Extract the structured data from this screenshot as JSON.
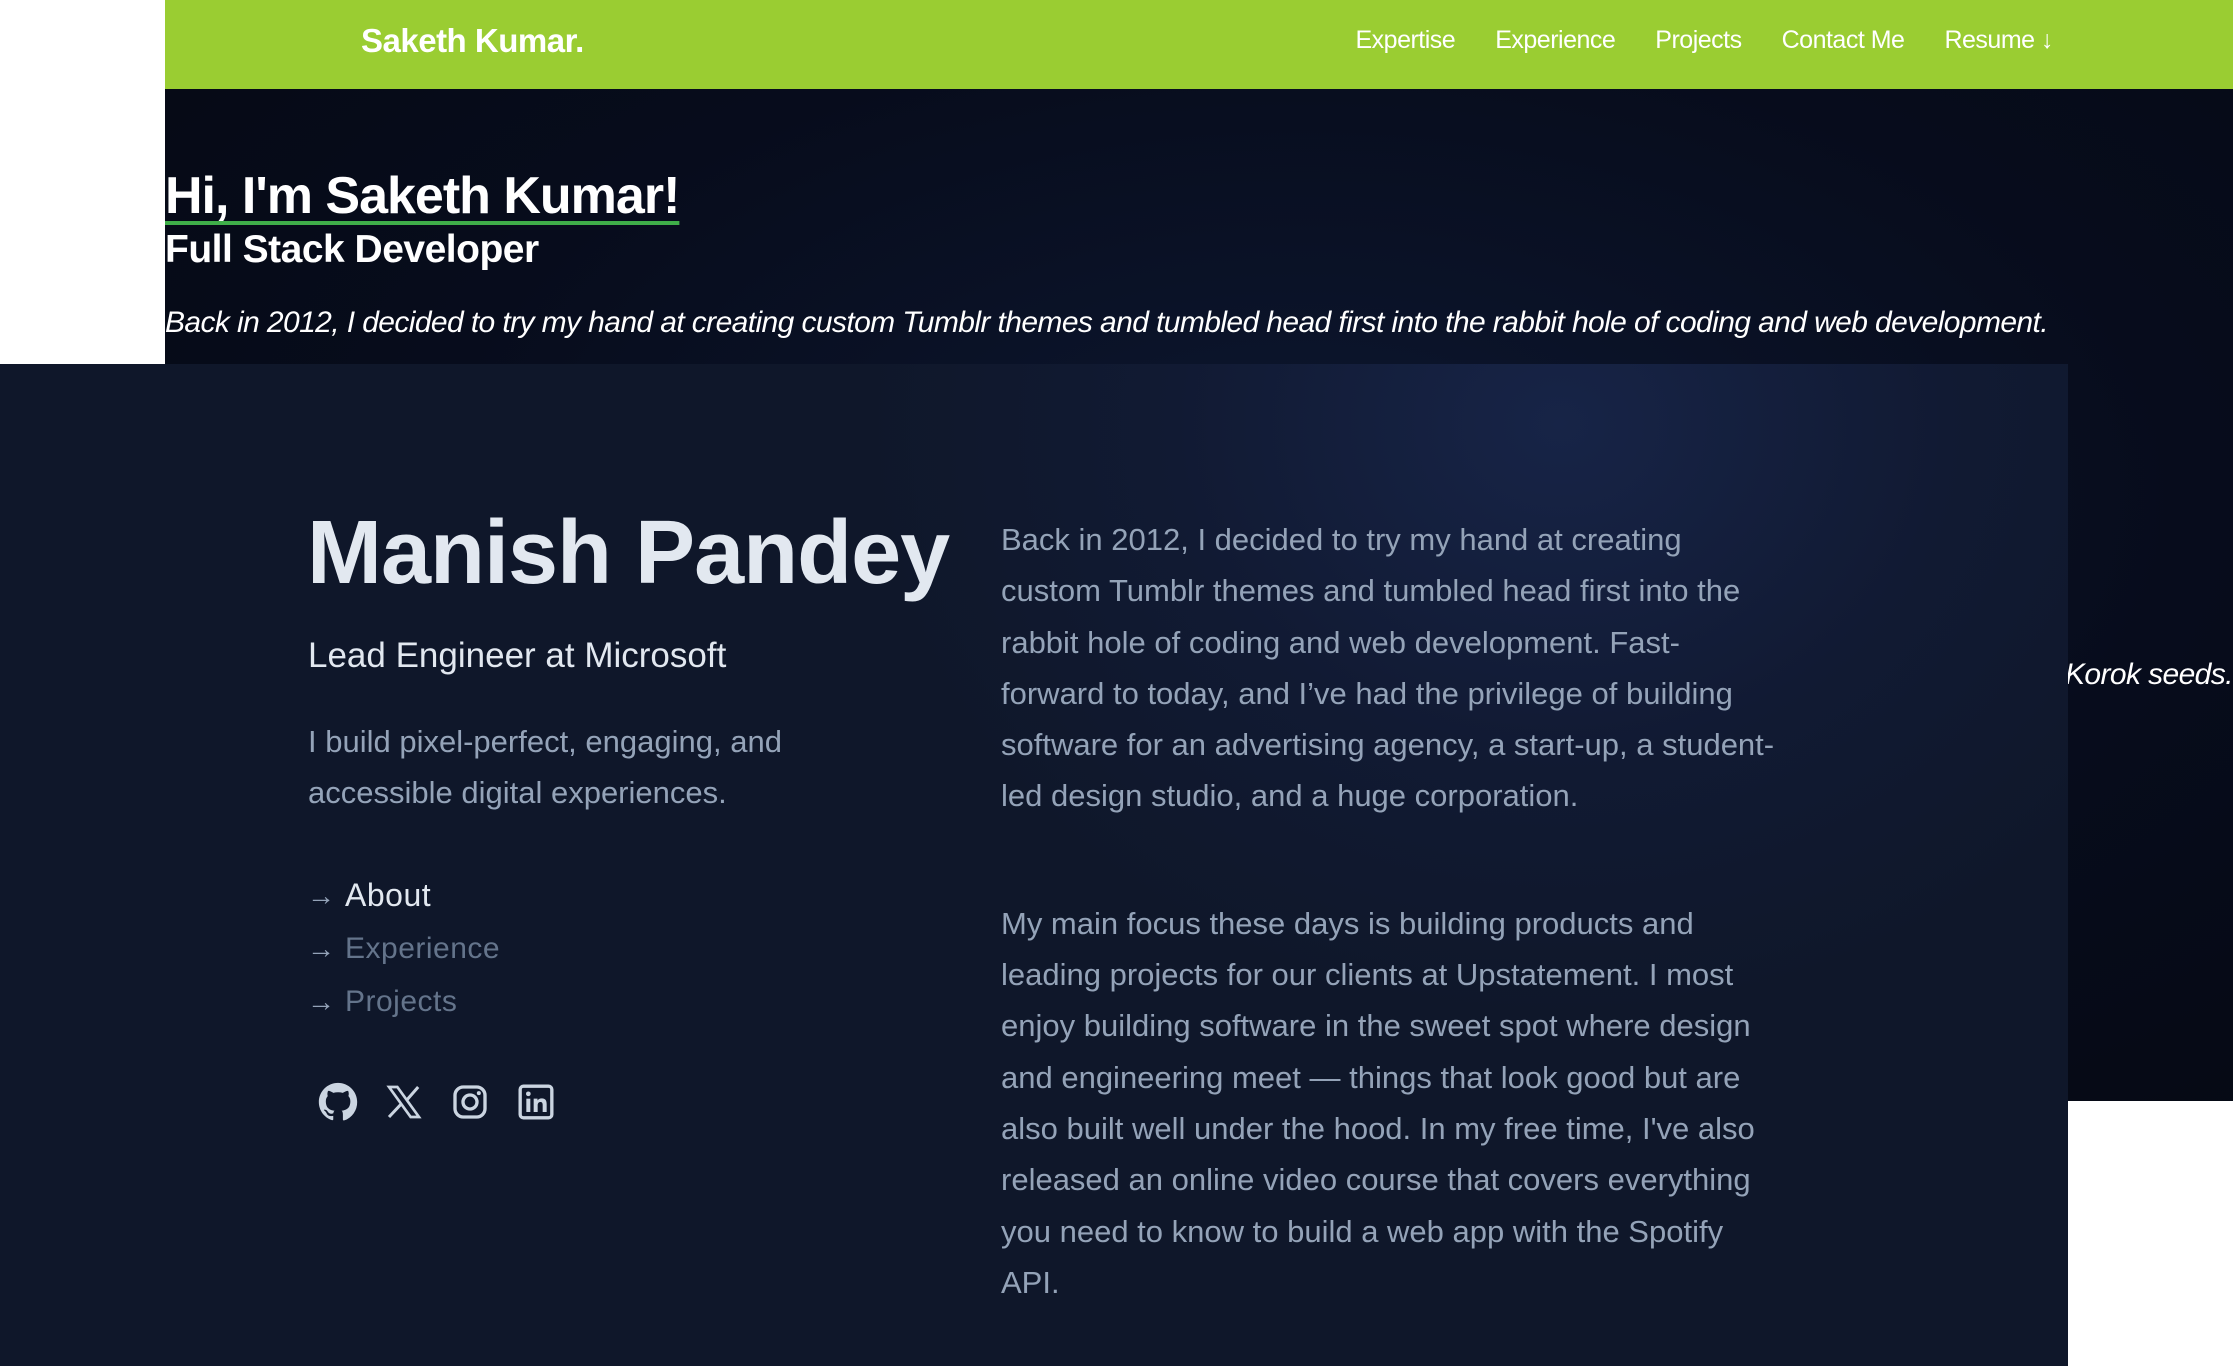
{
  "back": {
    "brand": "Saketh Kumar.",
    "nav": [
      "Expertise",
      "Experience",
      "Projects",
      "Contact Me",
      "Resume ↓"
    ],
    "hero_title": "Hi, I'm Saketh Kumar!",
    "hero_role": "Full Stack Developer",
    "hero_tagline": "Back in 2012, I decided to try my hand at creating custom Tumblr themes and tumbled head first into the rabbit hole of coding and web development.",
    "partial_text": "Korok seeds."
  },
  "front": {
    "name": "Manish Pandey",
    "subtitle": "Lead Engineer at Microsoft",
    "intro": "I build pixel-perfect, engaging, and accessible digital experiences.",
    "nav": [
      {
        "label": "About",
        "active": true
      },
      {
        "label": "Experience",
        "active": false
      },
      {
        "label": "Projects",
        "active": false
      }
    ],
    "socials": [
      "github-icon",
      "x-icon",
      "instagram-icon",
      "linkedin-icon"
    ],
    "about": [
      "Back in 2012, I decided to try my hand at creating custom Tumblr themes and tumbled head first into the rabbit hole of coding and web development. Fast-forward to today, and I’ve had the privilege of building software for an advertising agency, a start-up, a student-led design studio, and a huge corporation.",
      "My main focus these days is building products and leading projects for our clients at Upstatement. I most enjoy building software in the sweet spot where design and engineering meet — things that look good but are also built well under the hood. In my free time, I've also released an online video course that covers everything you need to know to build a web app with the Spotify API."
    ]
  },
  "colors": {
    "accent_green": "#9acd32",
    "underline_green": "#3fae49",
    "front_bg": "#0f172a",
    "text_light": "#e2e8f0",
    "text_muted": "#94a3b8"
  }
}
